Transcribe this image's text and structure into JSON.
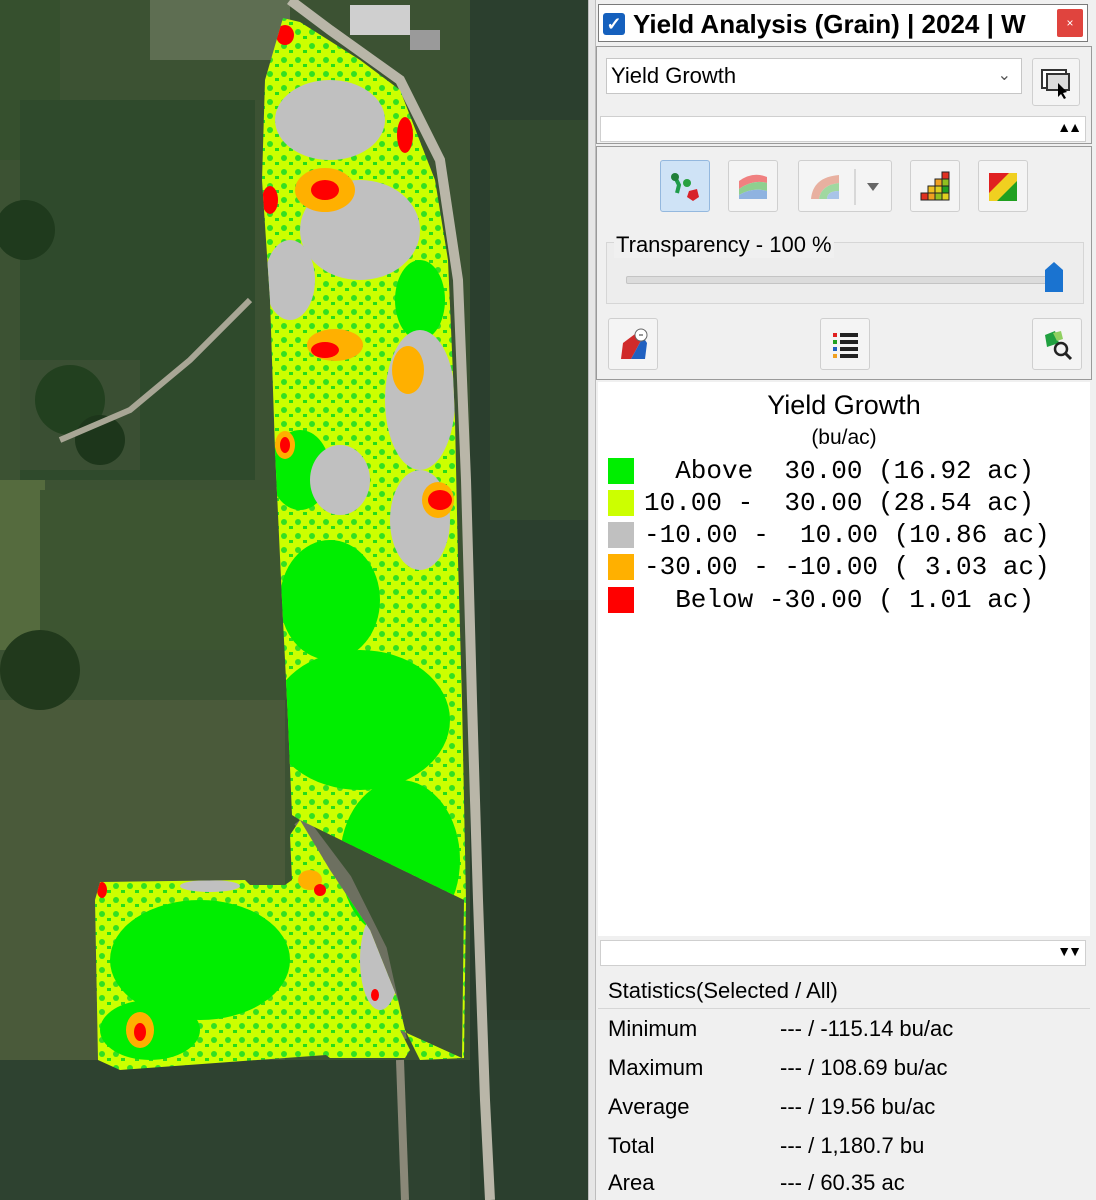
{
  "window": {
    "title": "Yield Analysis (Grain)  |  2024  |  W",
    "close_icon": "close-icon"
  },
  "layer_select": {
    "value": "Yield Growth"
  },
  "transparency": {
    "label": "Transparency - 100 %",
    "value_percent": 100
  },
  "toolbar": {
    "icons": [
      "points-polygon-icon",
      "surface-icon",
      "swath-icon",
      "histogram-icon",
      "color-ramp-icon",
      "paint-layer-icon",
      "legend-list-icon",
      "zoom-field-icon"
    ]
  },
  "legend": {
    "title": "Yield Growth",
    "unit": "(bu/ac)",
    "items": [
      {
        "color": "#00ee00",
        "text": "  Above  30.00 (16.92 ac)"
      },
      {
        "color": "#ccff00",
        "text": "10.00 -  30.00 (28.54 ac)"
      },
      {
        "color": "#c0c0c0",
        "text": "-10.00 -  10.00 (10.86 ac)"
      },
      {
        "color": "#ffb000",
        "text": "-30.00 - -10.00 ( 3.03 ac)"
      },
      {
        "color": "#ff0000",
        "text": "  Below -30.00 ( 1.01 ac)"
      }
    ]
  },
  "statistics": {
    "header": "Statistics(Selected / All)",
    "rows": [
      {
        "label": "Minimum",
        "value": "--- / -115.14 bu/ac"
      },
      {
        "label": "Maximum",
        "value": "--- / 108.69 bu/ac"
      },
      {
        "label": "Average",
        "value": "--- / 19.56 bu/ac"
      },
      {
        "label": "Total",
        "value": "--- / 1,180.7 bu"
      },
      {
        "label": "Area",
        "value": "--- / 60.35 ac"
      }
    ]
  }
}
